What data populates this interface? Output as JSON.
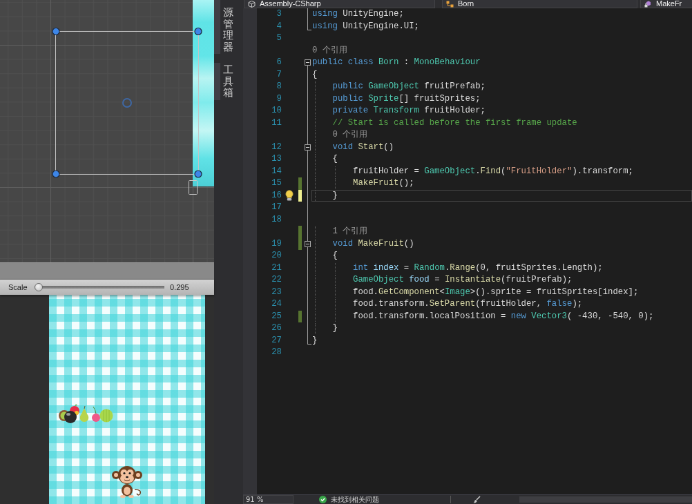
{
  "side_tabs": [
    {
      "label": "源管理器",
      "selected": false
    },
    {
      "label": "工具箱",
      "selected": false
    }
  ],
  "game_view": {
    "toolbar": {
      "label": "Scale",
      "slider": {
        "level": 0
      },
      "reading": "0.295"
    }
  },
  "editor": {
    "navigation": [
      {
        "kind": "project",
        "label": "Assembly-CSharp"
      },
      {
        "kind": "class",
        "label": "Born"
      },
      {
        "kind": "method",
        "label": "MakeFr"
      }
    ],
    "lines": [
      {
        "kind": "code",
        "number": "3",
        "outline": {
          "kind": "line"
        },
        "current": false,
        "lightbulb": false,
        "tokens": [
          {
            "kind": "keyword",
            "text": "using"
          },
          {
            "kind": "plain",
            "text": " UnityEngine;"
          }
        ]
      },
      {
        "kind": "code",
        "number": "4",
        "outline": {
          "kind": "end"
        },
        "current": false,
        "lightbulb": false,
        "tokens": [
          {
            "kind": "keyword",
            "text": "using"
          },
          {
            "kind": "plain",
            "text": " UnityEngine.UI;"
          }
        ]
      },
      {
        "kind": "code",
        "number": "5",
        "current": false,
        "lightbulb": false
      },
      {
        "kind": "codelens",
        "text": "0 个引用",
        "current": false,
        "lightbulb": false
      },
      {
        "kind": "code",
        "number": "6",
        "outline": {
          "kind": "fold",
          "expanded": true
        },
        "current": false,
        "lightbulb": false,
        "tokens": [
          {
            "kind": "keyword",
            "text": "public class "
          },
          {
            "kind": "type",
            "text": "Born"
          },
          {
            "kind": "plain",
            "text": " : "
          },
          {
            "kind": "type",
            "text": "MonoBehaviour"
          }
        ]
      },
      {
        "kind": "code",
        "number": "7",
        "outline": {
          "kind": "line"
        },
        "current": false,
        "lightbulb": false,
        "tokens": [
          {
            "kind": "plain",
            "text": "{"
          }
        ]
      },
      {
        "kind": "code",
        "number": "8",
        "outline": {
          "kind": "line"
        },
        "current": false,
        "lightbulb": false,
        "tokens": [
          {
            "kind": "keyword",
            "text": "    public "
          },
          {
            "kind": "type",
            "text": "GameObject"
          },
          {
            "kind": "plain",
            "text": " fruitPrefab;"
          }
        ]
      },
      {
        "kind": "code",
        "number": "9",
        "outline": {
          "kind": "line"
        },
        "current": false,
        "lightbulb": false,
        "tokens": [
          {
            "kind": "keyword",
            "text": "    public "
          },
          {
            "kind": "type",
            "text": "Sprite"
          },
          {
            "kind": "plain",
            "text": "[] fruitSprites;"
          }
        ]
      },
      {
        "kind": "code",
        "number": "10",
        "outline": {
          "kind": "line"
        },
        "current": false,
        "lightbulb": false,
        "tokens": [
          {
            "kind": "keyword",
            "text": "    private "
          },
          {
            "kind": "type",
            "text": "Transform"
          },
          {
            "kind": "plain",
            "text": " fruitHolder;"
          }
        ]
      },
      {
        "kind": "code",
        "number": "11",
        "outline": {
          "kind": "line"
        },
        "current": false,
        "lightbulb": false,
        "tokens": [
          {
            "kind": "comment",
            "text": "    // Start is called before the first frame update"
          }
        ]
      },
      {
        "kind": "codelens",
        "text": "    0 个引用",
        "outline": {
          "kind": "line"
        },
        "current": false,
        "lightbulb": false
      },
      {
        "kind": "code",
        "number": "12",
        "outline": {
          "kind": "fold",
          "expanded": true
        },
        "current": false,
        "lightbulb": false,
        "tokens": [
          {
            "kind": "keyword",
            "text": "    void "
          },
          {
            "kind": "method",
            "text": "Start"
          },
          {
            "kind": "plain",
            "text": "()"
          }
        ]
      },
      {
        "kind": "code",
        "number": "13",
        "outline": {
          "kind": "line"
        },
        "current": false,
        "lightbulb": false,
        "tokens": [
          {
            "kind": "plain",
            "text": "    {"
          }
        ]
      },
      {
        "kind": "code",
        "number": "14",
        "outline": {
          "kind": "line"
        },
        "current": false,
        "lightbulb": false,
        "tokens": [
          {
            "kind": "plain",
            "text": "        fruitHolder = "
          },
          {
            "kind": "type",
            "text": "GameObject"
          },
          {
            "kind": "plain",
            "text": "."
          },
          {
            "kind": "method",
            "text": "Find"
          },
          {
            "kind": "plain",
            "text": "("
          },
          {
            "kind": "string",
            "text": "\"FruitHolder\""
          },
          {
            "kind": "plain",
            "text": ").transform;"
          }
        ]
      },
      {
        "kind": "code",
        "number": "15",
        "outline": {
          "kind": "line"
        },
        "change": {
          "color": "#577430"
        },
        "current": false,
        "lightbulb": false,
        "tokens": [
          {
            "kind": "method",
            "text": "        MakeFruit"
          },
          {
            "kind": "plain",
            "text": "();"
          }
        ]
      },
      {
        "kind": "code",
        "number": "16",
        "outline": {
          "kind": "line"
        },
        "change": {
          "color": "#efef91"
        },
        "current": true,
        "lightbulb": true,
        "tokens": [
          {
            "kind": "plain",
            "text": "    }"
          }
        ]
      },
      {
        "kind": "code",
        "number": "17",
        "outline": {
          "kind": "line"
        },
        "current": false,
        "lightbulb": false
      },
      {
        "kind": "code",
        "number": "18",
        "outline": {
          "kind": "line"
        },
        "current": false,
        "lightbulb": false
      },
      {
        "kind": "codelens",
        "text": "    1 个引用",
        "outline": {
          "kind": "line"
        },
        "change": {
          "color": "#577430"
        },
        "current": false,
        "lightbulb": false
      },
      {
        "kind": "code",
        "number": "19",
        "outline": {
          "kind": "fold",
          "expanded": true
        },
        "change": {
          "color": "#577430"
        },
        "current": false,
        "lightbulb": false,
        "tokens": [
          {
            "kind": "keyword",
            "text": "    void "
          },
          {
            "kind": "method",
            "text": "MakeFruit"
          },
          {
            "kind": "plain",
            "text": "()"
          }
        ]
      },
      {
        "kind": "code",
        "number": "20",
        "outline": {
          "kind": "line"
        },
        "current": false,
        "lightbulb": false,
        "tokens": [
          {
            "kind": "plain",
            "text": "    {"
          }
        ]
      },
      {
        "kind": "code",
        "number": "21",
        "outline": {
          "kind": "line"
        },
        "current": false,
        "lightbulb": false,
        "tokens": [
          {
            "kind": "keyword",
            "text": "        int "
          },
          {
            "kind": "variable",
            "text": "index"
          },
          {
            "kind": "plain",
            "text": " = "
          },
          {
            "kind": "type",
            "text": "Random"
          },
          {
            "kind": "plain",
            "text": "."
          },
          {
            "kind": "method",
            "text": "Range"
          },
          {
            "kind": "plain",
            "text": "(0, fruitSprites.Length);"
          }
        ]
      },
      {
        "kind": "code",
        "number": "22",
        "outline": {
          "kind": "line"
        },
        "current": false,
        "lightbulb": false,
        "tokens": [
          {
            "kind": "type",
            "text": "        GameObject "
          },
          {
            "kind": "variable",
            "text": "food"
          },
          {
            "kind": "plain",
            "text": " = "
          },
          {
            "kind": "method",
            "text": "Instantiate"
          },
          {
            "kind": "plain",
            "text": "(fruitPrefab);"
          }
        ]
      },
      {
        "kind": "code",
        "number": "23",
        "outline": {
          "kind": "line"
        },
        "current": false,
        "lightbulb": false,
        "tokens": [
          {
            "kind": "plain",
            "text": "        food."
          },
          {
            "kind": "method",
            "text": "GetComponent"
          },
          {
            "kind": "plain",
            "text": "<"
          },
          {
            "kind": "type",
            "text": "Image"
          },
          {
            "kind": "plain",
            "text": ">().sprite = fruitSprites[index];"
          }
        ]
      },
      {
        "kind": "code",
        "number": "24",
        "outline": {
          "kind": "line"
        },
        "current": false,
        "lightbulb": false,
        "tokens": [
          {
            "kind": "plain",
            "text": "        food.transform."
          },
          {
            "kind": "method",
            "text": "SetParent"
          },
          {
            "kind": "plain",
            "text": "(fruitHolder, "
          },
          {
            "kind": "keyword",
            "text": "false"
          },
          {
            "kind": "plain",
            "text": ");"
          }
        ]
      },
      {
        "kind": "code",
        "number": "25",
        "outline": {
          "kind": "line"
        },
        "change": {
          "color": "#577430"
        },
        "current": false,
        "lightbulb": false,
        "tokens": [
          {
            "kind": "plain",
            "text": "        food.transform.localPosition = "
          },
          {
            "kind": "keyword",
            "text": "new "
          },
          {
            "kind": "type",
            "text": "Vector3"
          },
          {
            "kind": "plain",
            "text": "( -430, -540, 0);"
          }
        ]
      },
      {
        "kind": "code",
        "number": "26",
        "outline": {
          "kind": "line"
        },
        "current": false,
        "lightbulb": false,
        "tokens": [
          {
            "kind": "plain",
            "text": "    }"
          }
        ]
      },
      {
        "kind": "code",
        "number": "27",
        "outline": {
          "kind": "end"
        },
        "current": false,
        "lightbulb": false,
        "tokens": [
          {
            "kind": "plain",
            "text": "}"
          }
        ]
      },
      {
        "kind": "code",
        "number": "28",
        "current": false,
        "lightbulb": false
      }
    ]
  },
  "status_bar": {
    "zoom": "91 %",
    "issues": "未找到相关问题"
  }
}
